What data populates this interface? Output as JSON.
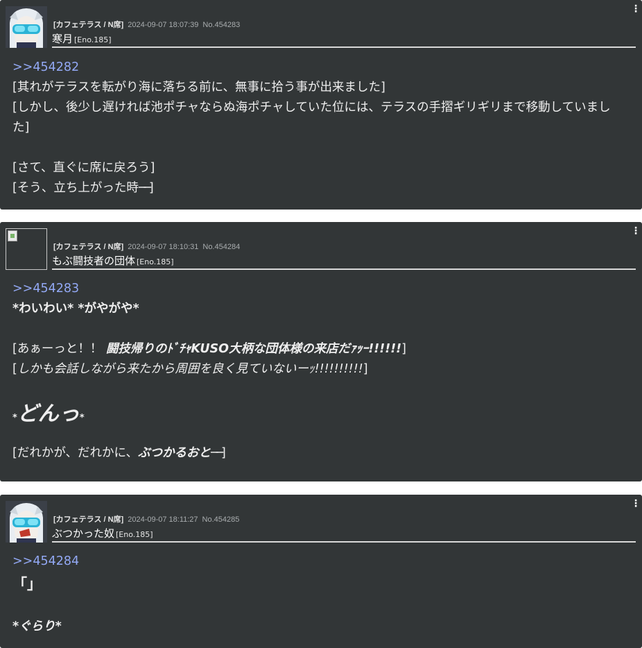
{
  "posts": [
    {
      "place": "[カフェテラス / N席]",
      "date": "2024-09-07 18:07:39",
      "number": "No.454283",
      "name": "寒月",
      "eno": "[Eno.185]",
      "reply_to": ">>454282",
      "lines": [
        "[其れがテラスを転がり海に落ちる前に、無事に拾う事が出来ました]",
        "[しかし、後少し遅ければ池ポチャならぬ海ポチャしていた位には、テラスの手摺ギリギリまで移動していました]",
        "[さて、直ぐに席に戻ろう]",
        "[そう、立ち上がった時",
        "──",
        "]"
      ]
    },
    {
      "place": "[カフェテラス / N席]",
      "date": "2024-09-07 18:10:31",
      "number": "No.454284",
      "name": "もぶ闘技者の団体",
      "eno": "[Eno.185]",
      "reply_to": ">>454283",
      "lines": [
        "*わいわい* *がやがや*",
        "[あぁーっと！！",
        "闘技帰りのﾄﾞﾁｬKUSO大柄な団体様の来店だｧｯｰ!!!!!!",
        "]",
        "[",
        "しかも会話しながら来たから周囲を良く見ていないーｯ!!!!!!!!!!",
        "]",
        "*",
        "どんっ",
        "*",
        "[だれかが、だれかに、",
        "ぶつかるおと",
        "──",
        "]"
      ]
    },
    {
      "place": "[カフェテラス / N席]",
      "date": "2024-09-07 18:11:27",
      "number": "No.454285",
      "name": "ぶつかった奴",
      "eno": "[Eno.185]",
      "reply_to": ">>454284",
      "lines": [
        "「」",
        "*ぐらり*"
      ]
    }
  ]
}
